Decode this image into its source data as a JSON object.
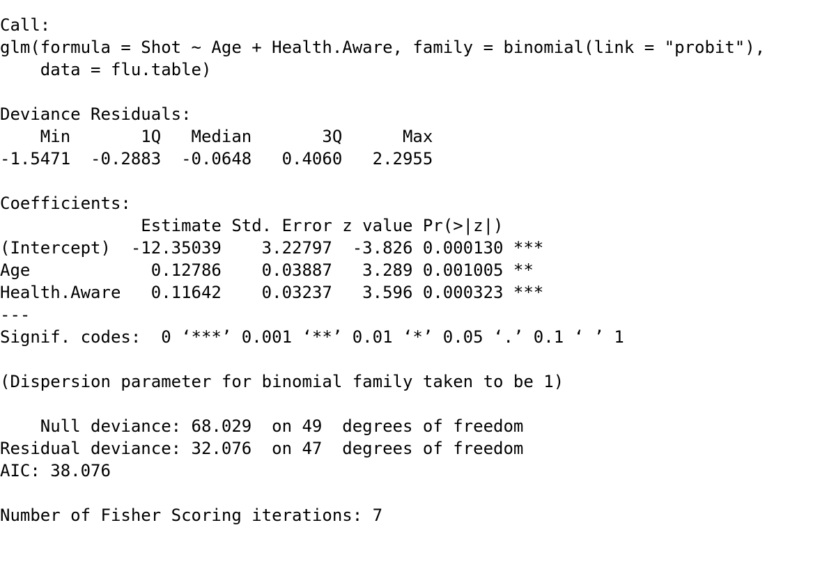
{
  "lines": [
    "Call:",
    "glm(formula = Shot ~ Age + Health.Aware, family = binomial(link = \"probit\"),",
    "    data = flu.table)",
    "",
    "Deviance Residuals:",
    "    Min       1Q   Median       3Q      Max  ",
    "-1.5471  -0.2883  -0.0648   0.4060   2.2955  ",
    "",
    "Coefficients:",
    "              Estimate Std. Error z value Pr(>|z|)    ",
    "(Intercept)  -12.35039    3.22797  -3.826 0.000130 ***",
    "Age            0.12786    0.03887   3.289 0.001005 ** ",
    "Health.Aware   0.11642    0.03237   3.596 0.000323 ***",
    "---",
    "Signif. codes:  0 ‘***’ 0.001 ‘**’ 0.01 ‘*’ 0.05 ‘.’ 0.1 ‘ ’ 1",
    "",
    "(Dispersion parameter for binomial family taken to be 1)",
    "",
    "    Null deviance: 68.029  on 49  degrees of freedom",
    "Residual deviance: 32.076  on 47  degrees of freedom",
    "AIC: 38.076",
    "",
    "Number of Fisher Scoring iterations: 7"
  ]
}
